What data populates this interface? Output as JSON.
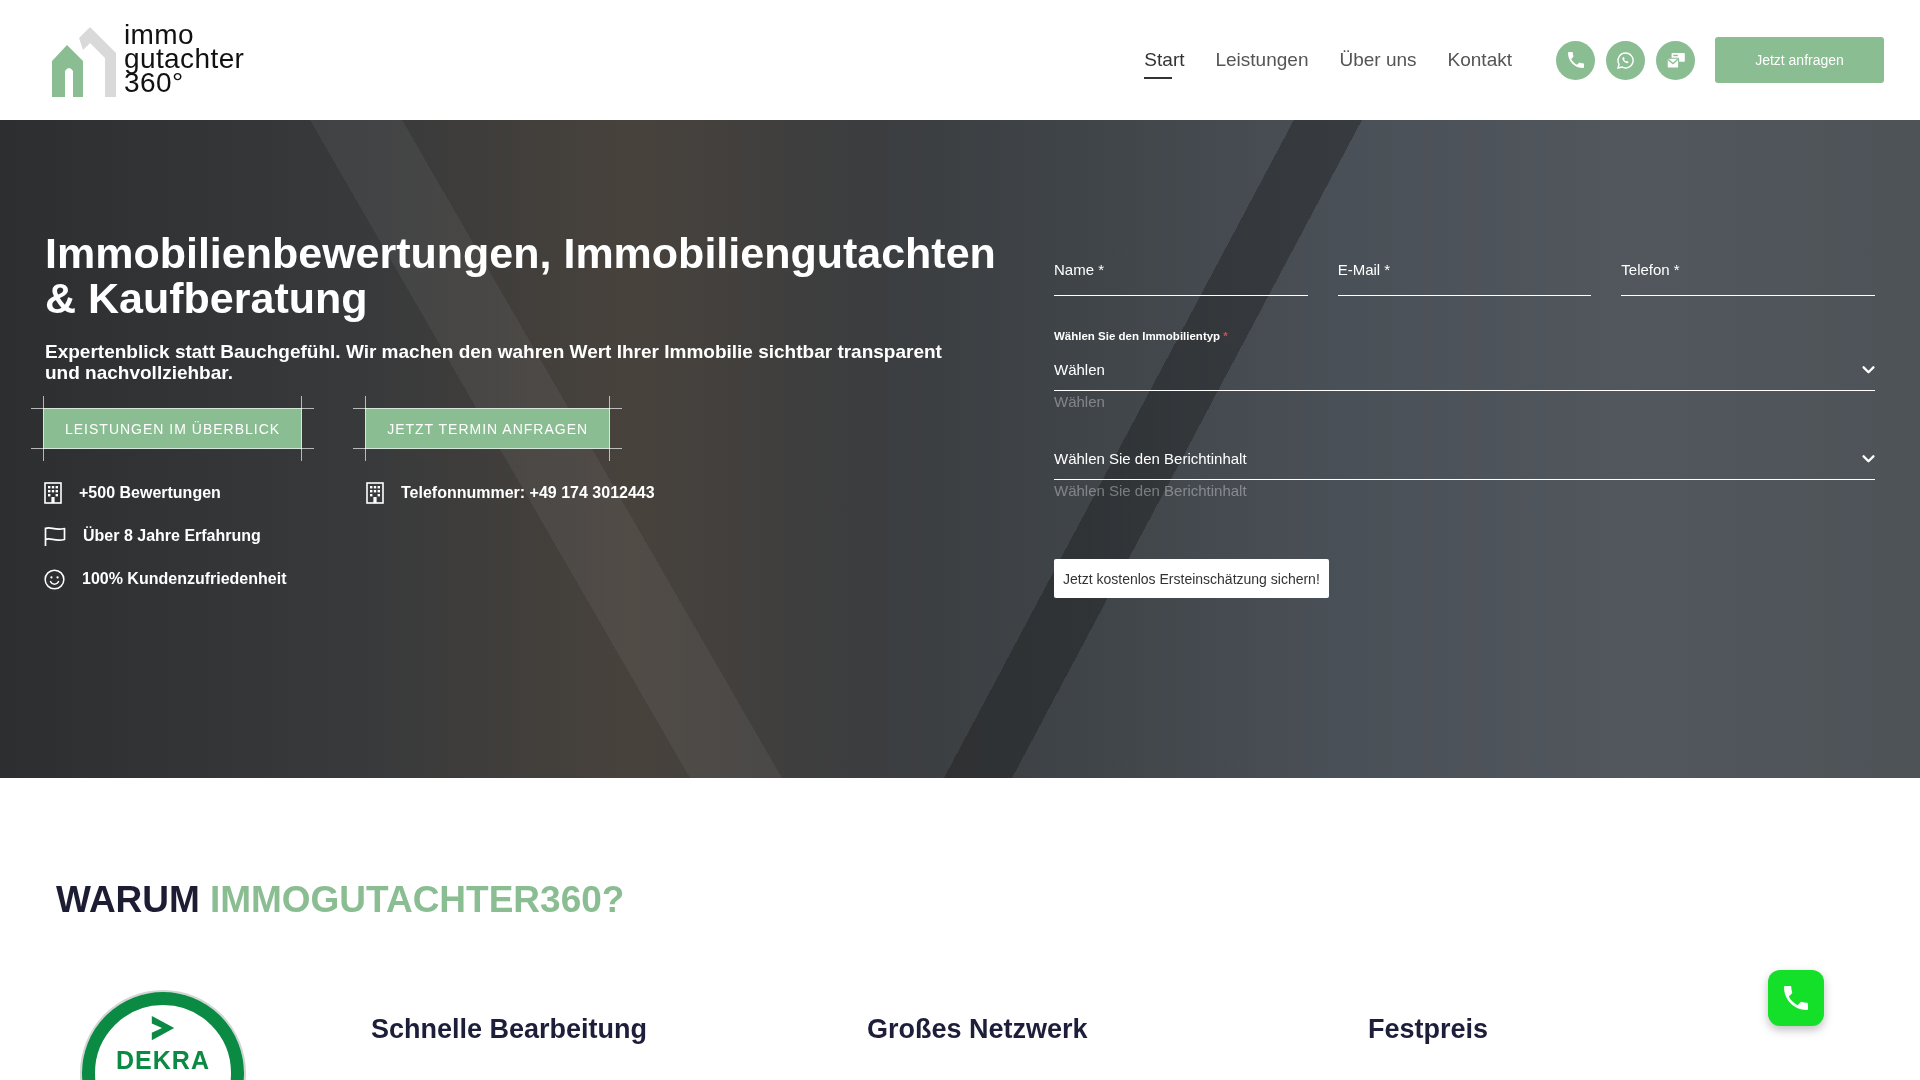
{
  "header": {
    "logo_lines": [
      "immo",
      "gutachter",
      "360°"
    ],
    "nav": [
      {
        "label": "Start",
        "selected": true
      },
      {
        "label": "Leistungen",
        "selected": false
      },
      {
        "label": "Über uns",
        "selected": false
      },
      {
        "label": "Kontakt",
        "selected": false
      }
    ],
    "cta": "Jetzt anfragen"
  },
  "hero": {
    "title": "Immobilienbewertungen, Immobiliengutachten & Kaufberatung",
    "subtitle": "Expertenblick statt Bauchgefühl. Wir machen den wahren Wert Ihrer Immobilie sichtbar transparent und nachvollziehbar.",
    "buttons": [
      "LEISTUNGEN IM ÜBERBLICK",
      "JETZT TERMIN ANFRAGEN"
    ],
    "facts": [
      "+500 Bewertungen",
      "Über 8 Jahre Erfahrung",
      "100% Kundenzufriedenheit"
    ],
    "phone": "Telefonnummer: +49 174 3012443"
  },
  "form": {
    "fields": [
      {
        "placeholder": "Name *"
      },
      {
        "placeholder": "E-Mail *"
      },
      {
        "placeholder": "Telefon *"
      }
    ],
    "selects": [
      {
        "label": "Wählen Sie den Immobilientyp",
        "required_mark": "*",
        "value": "Wählen",
        "hint": "Wählen"
      },
      {
        "value": "Wählen Sie den Berichtinhalt",
        "hint": "Wählen Sie den Berichtinhalt"
      }
    ],
    "submit": "Jetzt kostenlos Ersteinschätzung sichern!"
  },
  "why": {
    "heading_lead": "WARUM",
    "heading_accent": "IMMOGUTACHTER360?",
    "seal_label": "DEKRA",
    "features": [
      "Schnelle Bearbeitung",
      "Großes Netzwerk",
      "Festpreis"
    ]
  }
}
